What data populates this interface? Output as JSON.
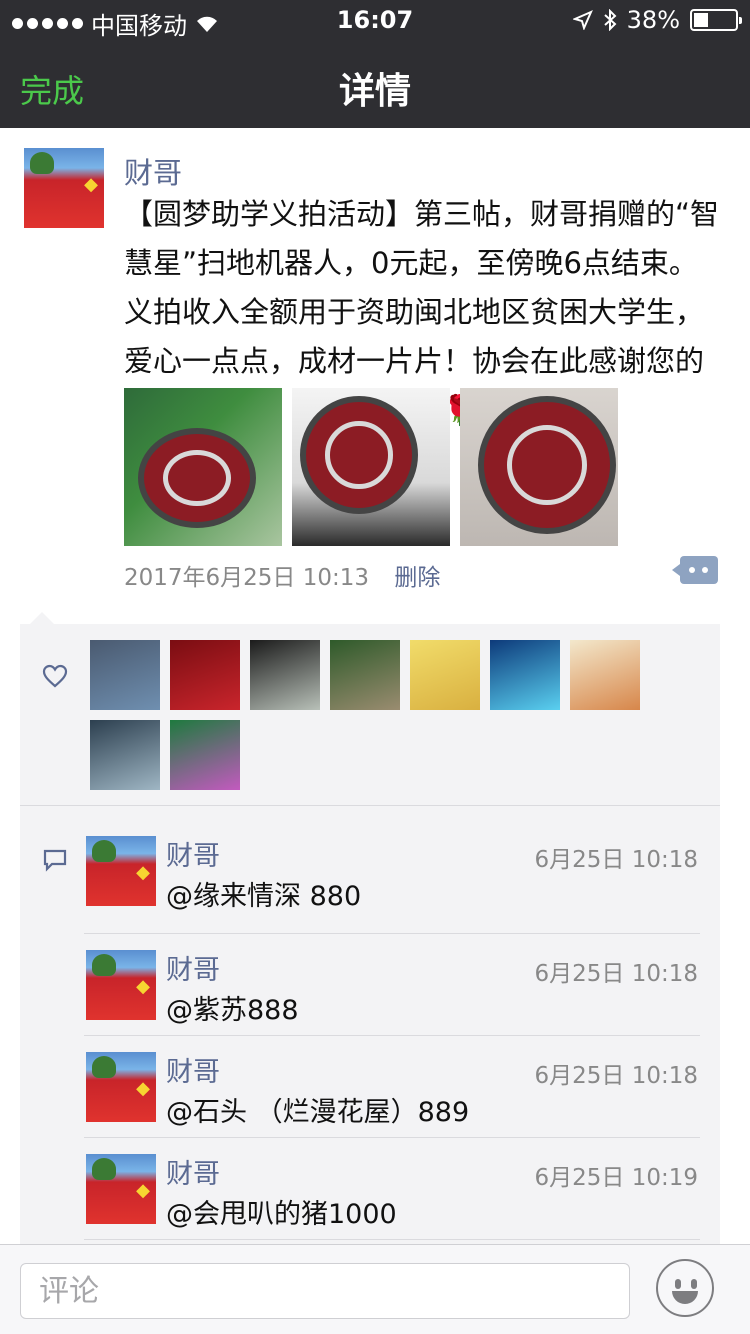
{
  "status_bar": {
    "carrier": "中国移动",
    "time": "16:07",
    "battery": "38%"
  },
  "nav": {
    "back_label": "完成",
    "title": "详情"
  },
  "post": {
    "author": "财哥",
    "content": "【圆梦助学义拍活动】第三帖，财哥捐赠的“智慧星”扫地机器人，0元起，至傍晚6点结束。义拍收入全额用于资助闽北地区贫困大学生，爱心一点点，成材一片片！协会在此感谢您的支持与帮助！🌹🌹🌹🌹🌹🌹",
    "timestamp": "2017年6月25日 10:13",
    "delete_label": "删除",
    "images": [
      {
        "name": "robot-photo-box"
      },
      {
        "name": "robot-photo-top"
      },
      {
        "name": "robot-photo-closeup"
      }
    ]
  },
  "likes": {
    "count": 9,
    "avatars": [
      {
        "color_a": "#4a5a70",
        "color_b": "#6f8fb0"
      },
      {
        "color_a": "#7a0d12",
        "color_b": "#c9252c"
      },
      {
        "color_a": "#1b1b1b",
        "color_b": "#b8c0b8"
      },
      {
        "color_a": "#2e5a2a",
        "color_b": "#9a8c70"
      },
      {
        "color_a": "#f1dc6a",
        "color_b": "#d9b040"
      },
      {
        "color_a": "#0d3a7a",
        "color_b": "#5ad0f0"
      },
      {
        "color_a": "#f3e8cc",
        "color_b": "#d7864a"
      },
      {
        "color_a": "#2c3f4f",
        "color_b": "#9fb6c4"
      },
      {
        "color_a": "#1e7a3e",
        "color_b": "#c35abf"
      }
    ]
  },
  "comments": [
    {
      "author": "财哥",
      "time": "6月25日 10:18",
      "text": "@缘来情深 880"
    },
    {
      "author": "财哥",
      "time": "6月25日 10:18",
      "text": "@紫苏888"
    },
    {
      "author": "财哥",
      "time": "6月25日 10:18",
      "text": "@石头 （烂漫花屋）889"
    },
    {
      "author": "财哥",
      "time": "6月25日 10:19",
      "text": "@会甩叭的猪1000"
    }
  ],
  "input": {
    "placeholder": "评论"
  },
  "colors": {
    "nav_bg": "#2e2e32",
    "accent_green": "#4bc94b",
    "link_blue": "#5b6a92"
  }
}
